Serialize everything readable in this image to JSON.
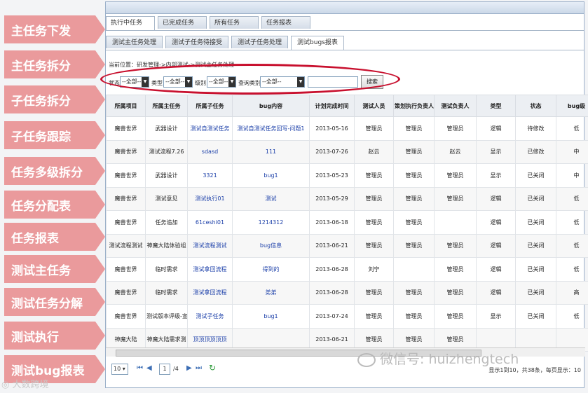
{
  "nav": [
    "主任务下发",
    "主任务拆分",
    "子任务拆分",
    "子任务跟踪",
    "任务多级拆分",
    "任务分配表",
    "任务报表",
    "测试主任务",
    "测试任务分解",
    "测试执行",
    "测试bug报表"
  ],
  "tabs": [
    "执行中任务",
    "已完成任务",
    "所有任务",
    "任务报表"
  ],
  "subtabs": [
    "测试主任务处理",
    "测试子任务待接受",
    "测试子任务处理",
    "测试bugs报表"
  ],
  "breadcrumb": "当前位置：研发管理->内部测试->测试主任务处理",
  "filter": {
    "status_label": "状态",
    "status_value": "--全部--",
    "type_label": "类型",
    "type_value": "--全部--",
    "level_label": "级别",
    "level_value": "--全部--",
    "query_label": "查询类别",
    "query_value": "--全部--",
    "search_button": "搜索"
  },
  "table": {
    "headers": [
      "所属项目",
      "所属主任务",
      "所属子任务",
      "bug内容",
      "计划完成时间",
      "测试人员",
      "策划执行负责人",
      "测试负责人",
      "类型",
      "状态",
      "bug级"
    ],
    "rows": [
      [
        "魔兽世界",
        "武器设计",
        "测试自测试任务",
        "测试自测试任务回写-问题1",
        "2013-05-16",
        "管理员",
        "管理员",
        "管理员",
        "逻辑",
        "待修改",
        "低"
      ],
      [
        "魔兽世界",
        "测试流程7.26",
        "sdasd",
        "111",
        "2013-07-26",
        "赵云",
        "管理员",
        "赵云",
        "显示",
        "已修改",
        "中"
      ],
      [
        "魔兽世界",
        "武器设计",
        "3321",
        "bug1",
        "2013-05-23",
        "管理员",
        "管理员",
        "管理员",
        "显示",
        "已关闭",
        "中"
      ],
      [
        "魔兽世界",
        "测试意见",
        "测试执行01",
        "测试",
        "2013-05-29",
        "管理员",
        "管理员",
        "管理员",
        "逻辑",
        "已关闭",
        "低"
      ],
      [
        "魔兽世界",
        "任务追加",
        "61ceshi01",
        "1214312",
        "2013-06-18",
        "管理员",
        "管理员",
        "",
        "逻辑",
        "已关闭",
        "低"
      ],
      [
        "测试流程测试",
        "神魔大陆体验组",
        "测试流程测试",
        "bug信息",
        "2013-06-21",
        "管理员",
        "管理员",
        "管理员",
        "逻辑",
        "已关闭",
        "低"
      ],
      [
        "魔兽世界",
        "临时需求",
        "测试拿回流程",
        "得到的",
        "2013-06-28",
        "刘宁",
        "",
        "管理员",
        "逻辑",
        "已关闭",
        "低"
      ],
      [
        "魔兽世界",
        "临时需求",
        "测试拿回流程",
        "弟弟",
        "2013-06-28",
        "管理员",
        "管理员",
        "管理员",
        "逻辑",
        "已关闭",
        "高"
      ],
      [
        "魔兽世界",
        "测试版本评级-宣",
        "测试子任务",
        "bug1",
        "2013-07-24",
        "管理员",
        "管理员",
        "管理员",
        "显示",
        "已关闭",
        "低"
      ],
      [
        "神魔大陆",
        "神魔大陆需求测",
        "顶顶顶顶顶顶",
        "",
        "2013-06-21",
        "管理员",
        "管理员",
        "管理员",
        "",
        "",
        ""
      ]
    ]
  },
  "pager": {
    "page_size": "10",
    "page": "1",
    "total_pages": "/4",
    "info": "显示1到10，共38条，每页显示：10"
  },
  "watermark": "微信号: huizhengtech",
  "logo": "大数跨境"
}
